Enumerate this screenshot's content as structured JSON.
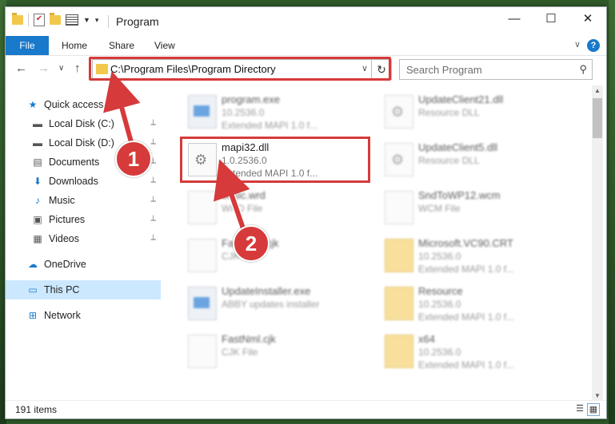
{
  "window": {
    "title": "Program",
    "controls": {
      "minimize": "—",
      "maximize": "☐",
      "close": "✕"
    }
  },
  "ribbon": {
    "tabs": [
      "File",
      "Home",
      "Share",
      "View"
    ],
    "help": "?",
    "expand": "∨"
  },
  "nav": {
    "back": "←",
    "forward": "→",
    "recent": "∨",
    "up": "↑",
    "address": "C:\\Program Files\\Program Directory",
    "address_dropdown": "∨",
    "refresh": "↻",
    "search_placeholder": "Search Program",
    "search_icon": "search-icon"
  },
  "sidebar": {
    "items": [
      {
        "label": "Quick access",
        "icon": "★",
        "icon_name": "star-icon",
        "pinned": false,
        "selected": false
      },
      {
        "label": "Local Disk (C:)",
        "icon": "▬",
        "icon_name": "drive-icon",
        "pinned": true,
        "selected": false
      },
      {
        "label": "Local Disk (D:)",
        "icon": "▬",
        "icon_name": "drive-icon",
        "pinned": true,
        "selected": false
      },
      {
        "label": "Documents",
        "icon": "▤",
        "icon_name": "documents-icon",
        "pinned": true,
        "selected": false
      },
      {
        "label": "Downloads",
        "icon": "⬇",
        "icon_name": "downloads-icon",
        "pinned": true,
        "selected": false
      },
      {
        "label": "Music",
        "icon": "♪",
        "icon_name": "music-icon",
        "pinned": true,
        "selected": false
      },
      {
        "label": "Pictures",
        "icon": "▣",
        "icon_name": "pictures-icon",
        "pinned": true,
        "selected": false
      },
      {
        "label": "Videos",
        "icon": "▦",
        "icon_name": "videos-icon",
        "pinned": true,
        "selected": false
      },
      {
        "label": "OneDrive",
        "icon": "☁",
        "icon_name": "onedrive-icon",
        "pinned": false,
        "selected": false
      },
      {
        "label": "This PC",
        "icon": "▭",
        "icon_name": "computer-icon",
        "pinned": false,
        "selected": true
      },
      {
        "label": "Network",
        "icon": "⊞",
        "icon_name": "network-icon",
        "pinned": false,
        "selected": false
      }
    ],
    "pin_glyph": "📌"
  },
  "files": [
    {
      "name": "program.exe",
      "line2": "10.2536.0",
      "line3": "Extended MAPI 1.0 f...",
      "icon": "exe",
      "blurred": true
    },
    {
      "name": "UpdateClient21.dll",
      "line2": "Resource DLL",
      "line3": "",
      "icon": "gear",
      "blurred": true
    },
    {
      "name": "mapi32.dll",
      "line2": "1.0.2536.0",
      "line3": "Extended MAPI 1.0 f...",
      "icon": "gear",
      "blurred": false
    },
    {
      "name": "UpdateClient5.dll",
      "line2": "Resource DLL",
      "line3": "",
      "icon": "gear",
      "blurred": true
    },
    {
      "name": "basic.wrd",
      "line2": "WRD File",
      "line3": "",
      "icon": "doc",
      "blurred": true
    },
    {
      "name": "SndToWP12.wcm",
      "line2": "WCM File",
      "line3": "",
      "icon": "doc",
      "blurred": true
    },
    {
      "name": "FastNext.cjk",
      "line2": "CJK File",
      "line3": "",
      "icon": "doc",
      "blurred": true
    },
    {
      "name": "Microsoft.VC90.CRT",
      "line2": "10.2536.0",
      "line3": "Extended MAPI 1.0 f...",
      "icon": "folder",
      "blurred": true
    },
    {
      "name": "UpdateInstaller.exe",
      "line2": "ABBY updates installer",
      "line3": "",
      "icon": "exe",
      "blurred": true
    },
    {
      "name": "Resource",
      "line2": "10.2536.0",
      "line3": "Extended MAPI 1.0 f...",
      "icon": "folder",
      "blurred": true
    },
    {
      "name": "FastNml.cjk",
      "line2": "CJK File",
      "line3": "",
      "icon": "doc",
      "blurred": true
    },
    {
      "name": "x64",
      "line2": "10.2536.0",
      "line3": "Extended MAPI 1.0 f...",
      "icon": "folder",
      "blurred": true
    }
  ],
  "status": {
    "count": "191 items"
  },
  "callouts": {
    "one": "1",
    "two": "2"
  },
  "colors": {
    "accent": "#1979ca",
    "highlight": "#d63a3a",
    "selected": "#cce8ff"
  }
}
